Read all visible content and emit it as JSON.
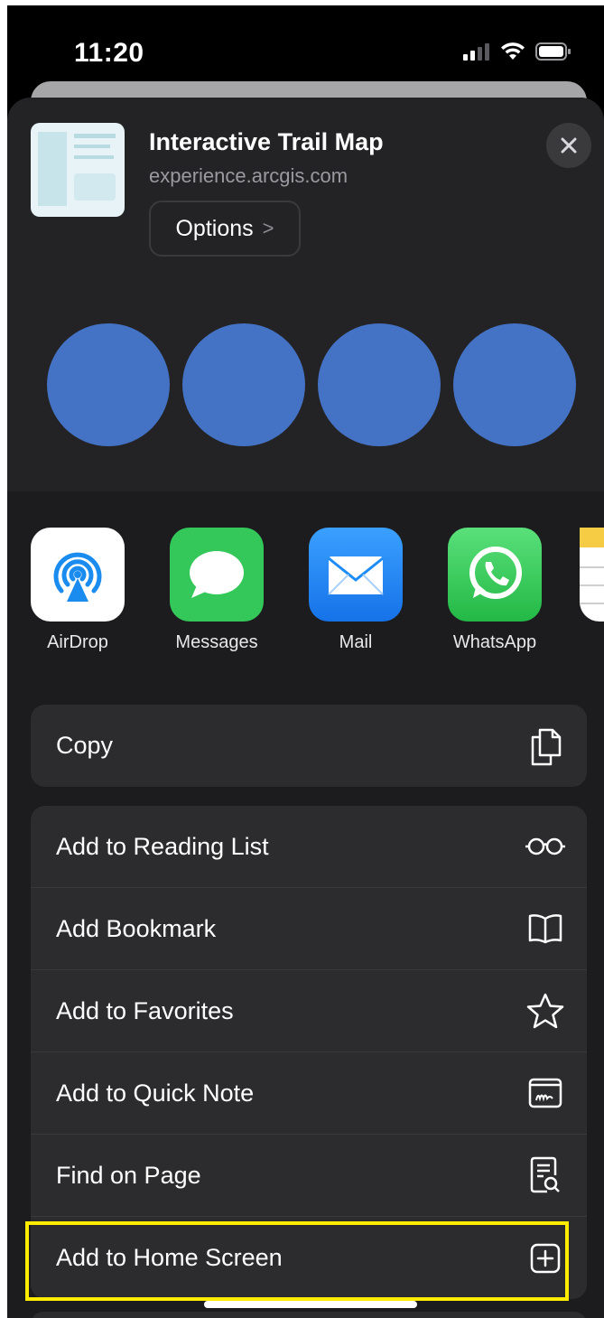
{
  "status": {
    "time": "11:20"
  },
  "header": {
    "title": "Interactive Trail Map",
    "url": "experience.arcgis.com",
    "options_label": "Options",
    "options_chevron": ">"
  },
  "apps": [
    {
      "label": "AirDrop",
      "icon": "airdrop-icon",
      "color": "#ffffff"
    },
    {
      "label": "Messages",
      "icon": "messages-icon",
      "color": "#34c759"
    },
    {
      "label": "Mail",
      "icon": "mail-icon",
      "color": "#1e8cf6"
    },
    {
      "label": "WhatsApp",
      "icon": "whatsapp-icon",
      "color": "#2fd25f"
    }
  ],
  "actions_group1": [
    {
      "label": "Copy",
      "icon": "copy-icon"
    }
  ],
  "actions_group2": [
    {
      "label": "Add to Reading List",
      "icon": "glasses-icon"
    },
    {
      "label": "Add Bookmark",
      "icon": "book-icon"
    },
    {
      "label": "Add to Favorites",
      "icon": "star-icon"
    },
    {
      "label": "Add to Quick Note",
      "icon": "quick-note-icon"
    },
    {
      "label": "Find on Page",
      "icon": "find-on-page-icon"
    },
    {
      "label": "Add to Home Screen",
      "icon": "plus-square-icon"
    }
  ],
  "colors": {
    "sheet": "#1c1c1e",
    "row": "#2c2c2e",
    "placeholder_circle": "#4472c4",
    "highlight": "#ffec00"
  }
}
